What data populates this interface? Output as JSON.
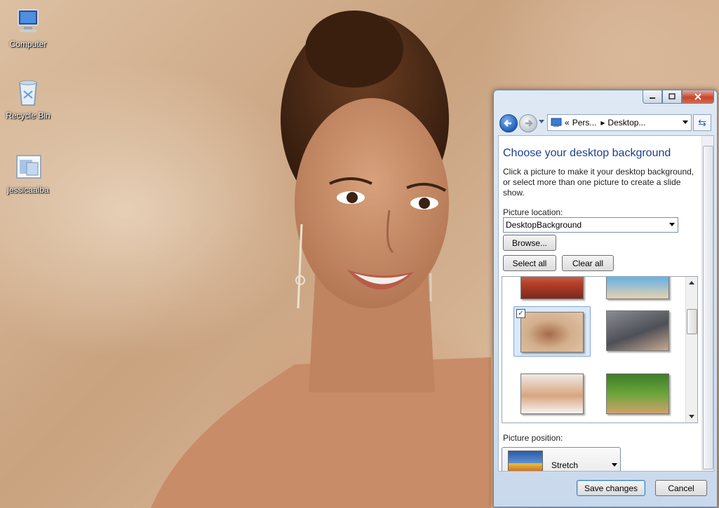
{
  "desktop": {
    "icons": [
      {
        "label": "Computer"
      },
      {
        "label": "Recycle Bin"
      },
      {
        "label": "jessicaalba"
      }
    ]
  },
  "window": {
    "address": {
      "chevrons": "«",
      "crumb1": "Pers...",
      "crumb2": "Desktop..."
    },
    "heading": "Choose your desktop background",
    "description": "Click a picture to make it your desktop background, or select more than one picture to create a slide show.",
    "picture_location": {
      "label": "Picture location:",
      "value": "DesktopBackground"
    },
    "browse_label": "Browse...",
    "select_all_label": "Select all",
    "clear_all_label": "Clear all",
    "gallery": {
      "selected_index": 2,
      "checked_mark": "✓"
    },
    "picture_position": {
      "label": "Picture position:",
      "value": "Stretch"
    },
    "save_label": "Save changes",
    "cancel_label": "Cancel"
  }
}
